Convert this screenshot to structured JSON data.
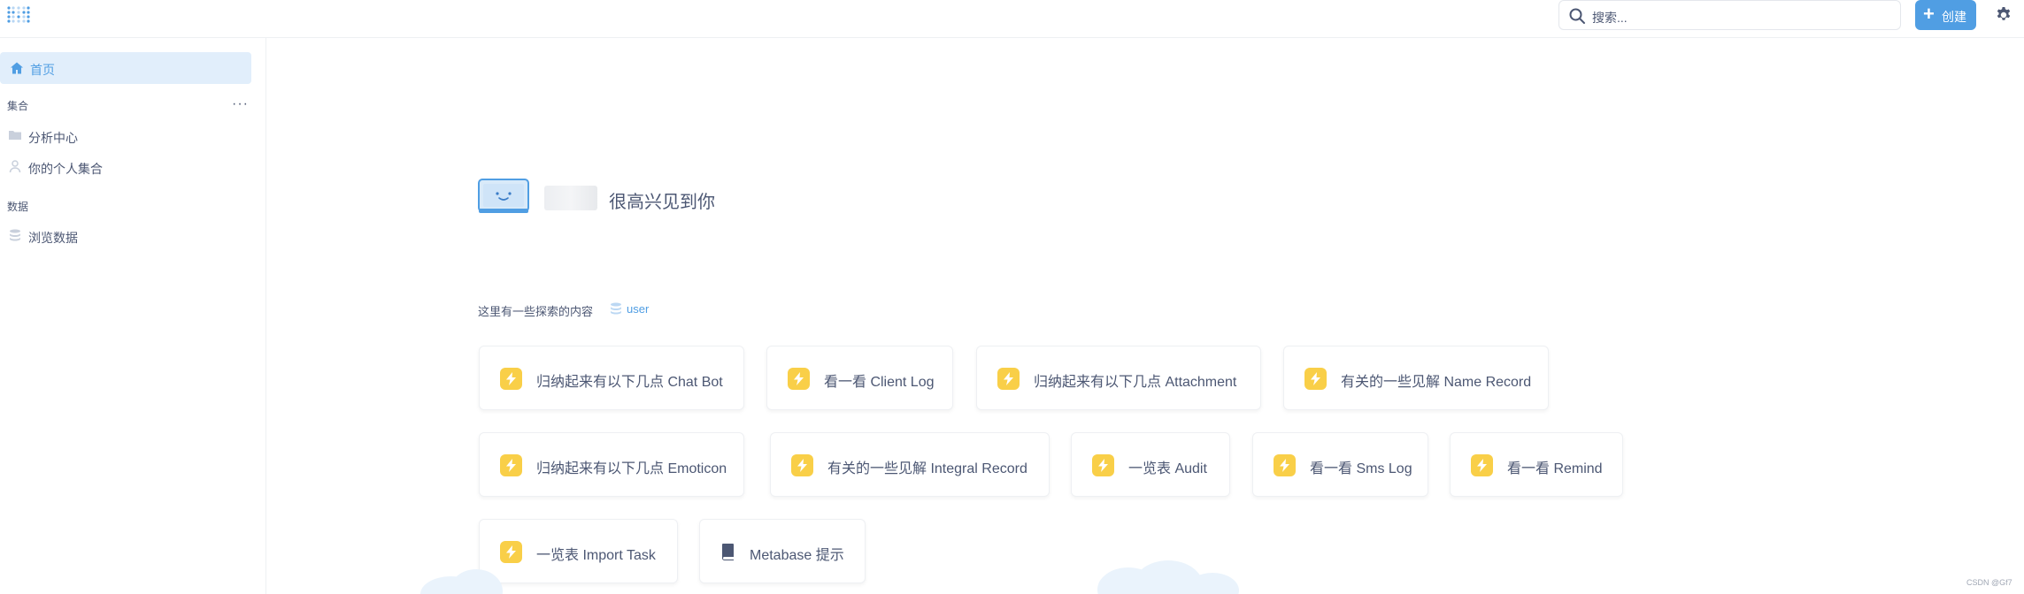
{
  "topbar": {
    "search_placeholder": "搜索...",
    "create_label": "创建",
    "brand_color": "#509ee3"
  },
  "sidebar": {
    "home_label": "首页",
    "collections_title": "集合",
    "collections": [
      {
        "label": "分析中心",
        "icon": "folder-icon"
      },
      {
        "label": "你的个人集合",
        "icon": "person-icon"
      }
    ],
    "data_title": "数据",
    "data_items": [
      {
        "label": "浏览数据",
        "icon": "database-icon"
      }
    ]
  },
  "main": {
    "greeting": "很高兴见到你",
    "explore_label": "这里有一些探索的内容",
    "explore_db": "user",
    "cards": [
      {
        "label": "归纳起来有以下几点 Chat Bot",
        "icon": "bolt-icon"
      },
      {
        "label": "看一看 Client Log",
        "icon": "bolt-icon"
      },
      {
        "label": "归纳起来有以下几点 Attachment",
        "icon": "bolt-icon"
      },
      {
        "label": "有关的一些见解 Name Record",
        "icon": "bolt-icon"
      },
      {
        "label": "归纳起来有以下几点 Emoticon",
        "icon": "bolt-icon"
      },
      {
        "label": "有关的一些见解 Integral Record",
        "icon": "bolt-icon"
      },
      {
        "label": "一览表 Audit",
        "icon": "bolt-icon"
      },
      {
        "label": "看一看 Sms Log",
        "icon": "bolt-icon"
      },
      {
        "label": "看一看 Remind",
        "icon": "bolt-icon"
      },
      {
        "label": "一览表 Import Task",
        "icon": "bolt-icon"
      },
      {
        "label": "Metabase 提示",
        "icon": "book-icon"
      }
    ]
  },
  "watermark": "CSDN @Gf7"
}
